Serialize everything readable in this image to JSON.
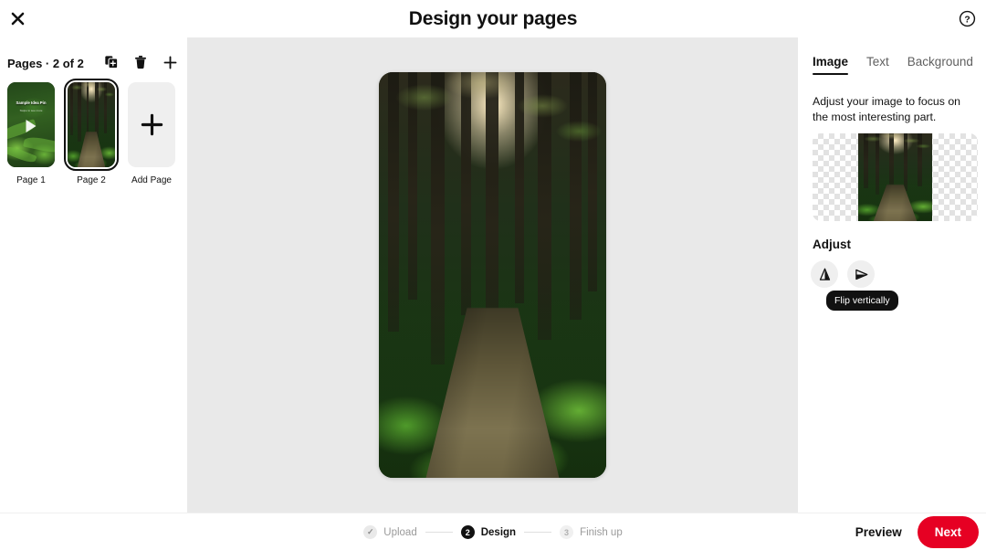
{
  "header": {
    "title": "Design your pages",
    "close_icon": "close-icon",
    "help_icon": "question-mark-circle-icon"
  },
  "sidebar": {
    "pages_label": "Pages · 2 of 2",
    "tools": [
      {
        "name": "duplicate-page-button",
        "icon": "duplicate-icon"
      },
      {
        "name": "delete-page-button",
        "icon": "trash-icon"
      },
      {
        "name": "add-page-button",
        "icon": "plus-icon"
      }
    ],
    "thumbs": [
      {
        "label": "Page 1",
        "selected": false,
        "overlay_title": "Sample Idea Pin",
        "overlay_sub": "Swipe to see more",
        "has_play": true
      },
      {
        "label": "Page 2",
        "selected": true,
        "has_play": false
      }
    ],
    "add_page": {
      "label": "Add Page",
      "icon": "plus-icon"
    }
  },
  "panel": {
    "tabs": [
      {
        "label": "Image",
        "active": true
      },
      {
        "label": "Text",
        "active": false
      },
      {
        "label": "Background",
        "active": false
      }
    ],
    "description": "Adjust your image to focus on the most interesting part.",
    "adjust_title": "Adjust",
    "buttons": [
      {
        "name": "flip-vertically-button",
        "icon": "flip-vertical-icon"
      },
      {
        "name": "flip-horizontally-button",
        "icon": "flip-horizontal-icon"
      }
    ],
    "tooltip": "Flip vertically"
  },
  "footer": {
    "steps": [
      {
        "badge": "✓",
        "label": "Upload",
        "state": "done"
      },
      {
        "badge": "2",
        "label": "Design",
        "state": "current"
      },
      {
        "badge": "3",
        "label": "Finish up",
        "state": "todo"
      }
    ],
    "preview_label": "Preview",
    "next_label": "Next"
  },
  "colors": {
    "accent": "#e60023",
    "canvas_bg": "#e9e9e9",
    "text": "#111111",
    "muted": "#9a9a9a"
  }
}
